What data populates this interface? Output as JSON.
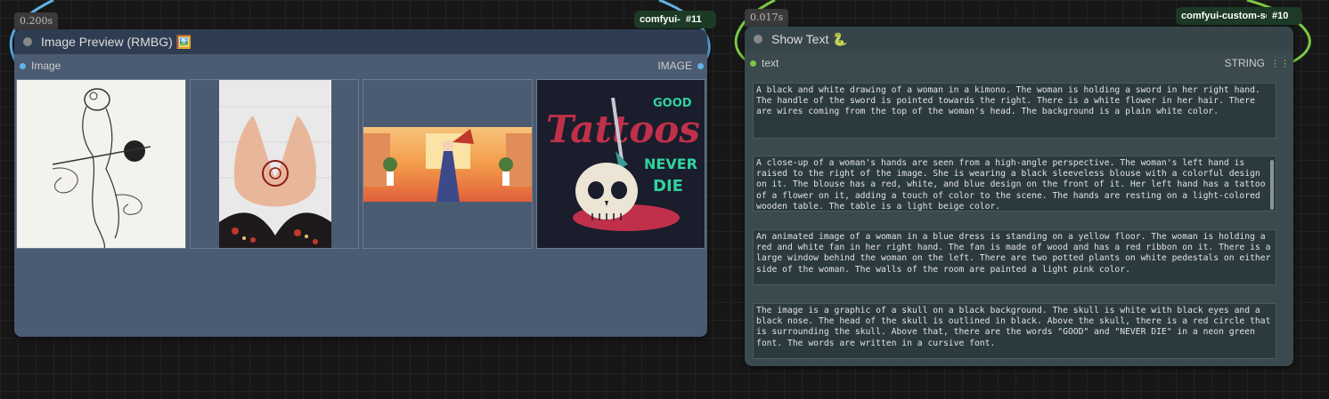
{
  "node_preview": {
    "timing": "0.200s",
    "pack_badge": "comfyui-",
    "node_id": "#11",
    "title": "Image Preview (RMBG) 🖼️",
    "input_label": "Image",
    "output_label": "IMAGE",
    "thumbnails": [
      "kimono-woman-drawing",
      "henna-hands",
      "anime-fan-dancer",
      "tattoo-skull-graphic"
    ],
    "accent_color": "#5fb3e8"
  },
  "node_text": {
    "timing": "0.017s",
    "pack_badge": "comfyui-custom-sc",
    "node_id": "#10",
    "title": "Show Text 🐍",
    "input_label": "text",
    "output_label": "STRING",
    "accent_color": "#7ac943",
    "texts": [
      "A black and white drawing of a woman in a kimono. The woman is holding a sword in her right hand. The handle of the sword is pointed towards the right. There is a white flower in her hair. There are wires coming from the top of the woman's head. The background is a plain white color.",
      "A close-up of a woman's hands are seen from a high-angle perspective. The woman's left hand is raised to the right of the image. She is wearing a black sleeveless blouse with a colorful design on it. The blouse has a red, white, and blue design on the front of it. Her left hand has a tattoo of a flower on it, adding a touch of color to the scene. The hands are resting on a light-colored wooden table. The table is a light beige color.",
      "An animated image of a woman in a blue dress is standing on a yellow floor. The woman is holding a red and white fan in her right hand. The fan is made of wood and has a red ribbon on it. There is a large window behind the woman on the left. There are two potted plants on white pedestals on either side of the woman. The walls of the room are painted a light pink color.",
      "The image is a graphic of a skull on a black background. The skull is white with black eyes and a black nose. The head of the skull is outlined in black. Above the skull, there is a red circle that is surrounding the skull. Above that, there are the words \"GOOD\" and \"NEVER DIE\" in a neon green font. The words are written in a cursive font."
    ]
  },
  "thumb4_text": {
    "good": "GOOD",
    "tattoos": "Tattoos",
    "never": "NEVER",
    "die": "DIE"
  }
}
